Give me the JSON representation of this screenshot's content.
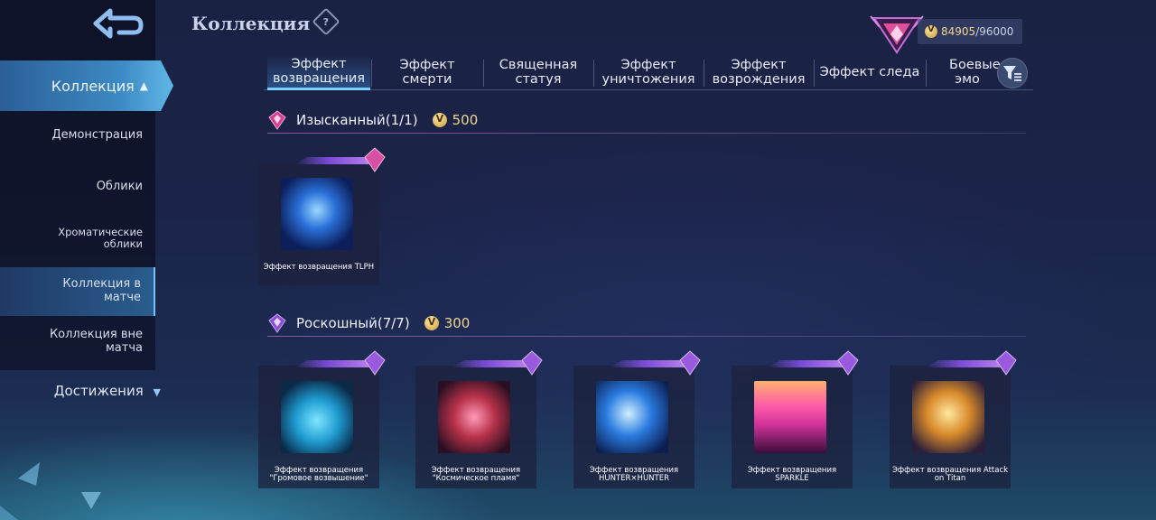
{
  "header": {
    "title": "Коллекция",
    "help_icon": "help-diamond-icon",
    "currency": {
      "current": "84905",
      "max": "/96000"
    }
  },
  "sidebar": {
    "back_icon": "back-arrow-icon",
    "active_group": "Коллекция",
    "items": [
      {
        "label": "Демонстрация"
      },
      {
        "label": "Облики"
      },
      {
        "label": "Хроматические облики"
      },
      {
        "label": "Коллекция в матче"
      },
      {
        "label": "Коллекция вне матча"
      }
    ],
    "achievements": "Достижения"
  },
  "tabs": [
    {
      "label": "Эффект возвращения",
      "active": true
    },
    {
      "label": "Эффект смерти"
    },
    {
      "label": "Священная статуя"
    },
    {
      "label": "Эффект уничтожения"
    },
    {
      "label": "Эффект возрождения"
    },
    {
      "label": "Эффект следа"
    },
    {
      "label": "Боевые эмо"
    }
  ],
  "sections": [
    {
      "title": "Изысканный",
      "count": "(1/1)",
      "price": "500",
      "items": [
        {
          "label": "Эффект возвращения TLPH",
          "color": "#2a6fd8"
        }
      ]
    },
    {
      "title": "Роскошный",
      "count": "(7/7)",
      "price": "300",
      "items": [
        {
          "label": "Эффект возвращения \"Громовое возвышение\"",
          "color": "#1f9bd1"
        },
        {
          "label": "Эффект возвращения \"Космическое пламя\"",
          "color": "#b8324a"
        },
        {
          "label": "Эффект возвращения HUNTER×HUNTER",
          "color": "#2a7be0"
        },
        {
          "label": "Эффект возвращения SPARKLE",
          "color": "#d2339a"
        },
        {
          "label": "Эффект возвращения Attack on Titan",
          "color": "#d88a2a"
        }
      ]
    }
  ],
  "colors": {
    "accent": "#7ad0ff",
    "gold": "#f0d68c",
    "purple": "#9a5ae0"
  }
}
